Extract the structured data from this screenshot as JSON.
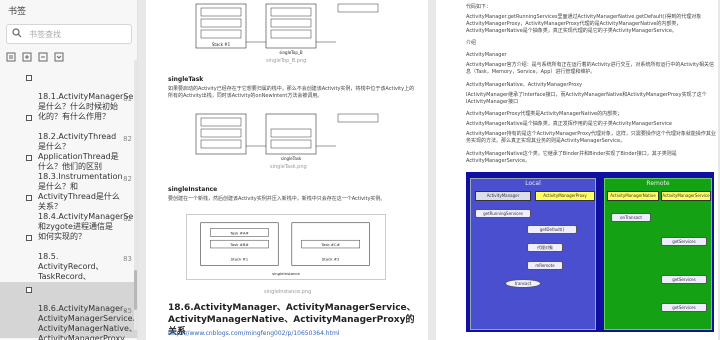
{
  "sidebar": {
    "title": "书签",
    "search_placeholder": "书签查找",
    "items": [
      {
        "label": "18.1.ActivityManagerService是什么？什么时候初始化的？有什么作用？",
        "page": "81"
      },
      {
        "label": "18.2.ActivityThread是什么？ApplicationThread是什么？他们的区别",
        "page": "82"
      },
      {
        "label": "18.3.Instrumentation是什么？和ActivityThread是什么关系？",
        "page": "82"
      },
      {
        "label": "18.4.ActivityManagerService和zygote进程通信是如何实现的？",
        "page": "82"
      },
      {
        "label": "18.5. ActivityRecord、TaskRecord、ActivityStack、ActivityStackSupervisor、ProcessRecord",
        "page": "83"
      },
      {
        "label": "18.6.ActivityManager、ActivityManagerService、ActivityManagerNative、ActivityManagerProxy",
        "page": "85"
      }
    ]
  },
  "left_page": {
    "singletop_caption": "singleTop_B.png",
    "singletask_heading": "singleTask",
    "singletask_text": "如果要启动的Activity已经存在于它想要归属的栈中，那么不会创建该Activity实例，将栈中位于该Activity上的所有的Activity出栈，同时该Activity的onNewIntent方法会被调用。",
    "singletask_caption": "singleTask.png",
    "singleinstance_heading": "singleInstance",
    "singleinstance_text": "要创建在一个新栈，然后创建该Activity实例并压入新栈中，新栈中只会存在这一个Activity实例。",
    "singleinstance_caption": "singleInstance.png",
    "diagram_labels": {
      "task_a": "Task #A#",
      "task_b": "Task #B#",
      "task_c": "Task #C#",
      "task_d": "Task #D#",
      "stack": "Stack #1",
      "stack_2": "Stack #2",
      "single_top": "singleTop_B",
      "single_task": "singleTask",
      "single_instance": "singleInstance"
    },
    "section_heading": "18.6.ActivityManager、ActivityManagerService、ActivityManagerNative、ActivityManagerProxy的关系",
    "url": "https://www.cnblogs.com/mingfeng002/p/10650364.html"
  },
  "right_page": {
    "lines": [
      "代码如下：",
      "ActivityManager.getRunningServices里面通过ActivityManagerNative.getDefault()得到的代理对象ActivityManagerProxy，ActivityManagerProxy代理的是ActivityManagerNative的内部类，ActivityManagerNative是个抽象类，真正实现代理的是它的子类ActivityManagerService。",
      "介绍",
      "ActivityManager",
      "ActivityManager官方介绍：是与系统所有正在运行着的Activity进行交互，对系统所有运行中的Activity相关信息（Task，Memory，Service，App）进行管理和维护。",
      "ActivityManagerNative、ActivityManagerProxy",
      "IActivityManager继承了Interface接口，而ActivityManagerNative和ActivityManagerProxy实现了这个IActivityManager接口",
      "ActivityManagerProxy代理类是ActivityManagerNative的内部类；",
      "ActivityManagerNative是个抽象类，真正发挥作用的是它的子类ActivityManagerService",
      "ActivityManager持有的是这个ActivityManagerProxy代理对象，这样，只需要操作这个代理对象就能操作其业务实现的方法。那么真正实现其业务的则是ActivityManagerService。",
      "ActivityManagerNative这个类，它继承了Binder并和Binder实现了Binder接口，其子类则是ActivityManagerService。"
    ],
    "diagram": {
      "local_label": "Local",
      "remote_label": "Remote",
      "actors": [
        "ActivityManager",
        "ActivityManagerProxy",
        "ActivityManagerNative",
        "ActivityManagerService"
      ],
      "messages": [
        "getRunningServices",
        "getDefault()",
        "代理对象",
        "mRemote",
        "transact",
        "onTransact",
        "getServices",
        "getServices",
        "getServices"
      ]
    }
  },
  "colors": {
    "local_region": "#4a4fd0",
    "remote_region": "#14a114",
    "diagram_bg": "#0f10a0",
    "active_item": "#d5d5d5"
  }
}
